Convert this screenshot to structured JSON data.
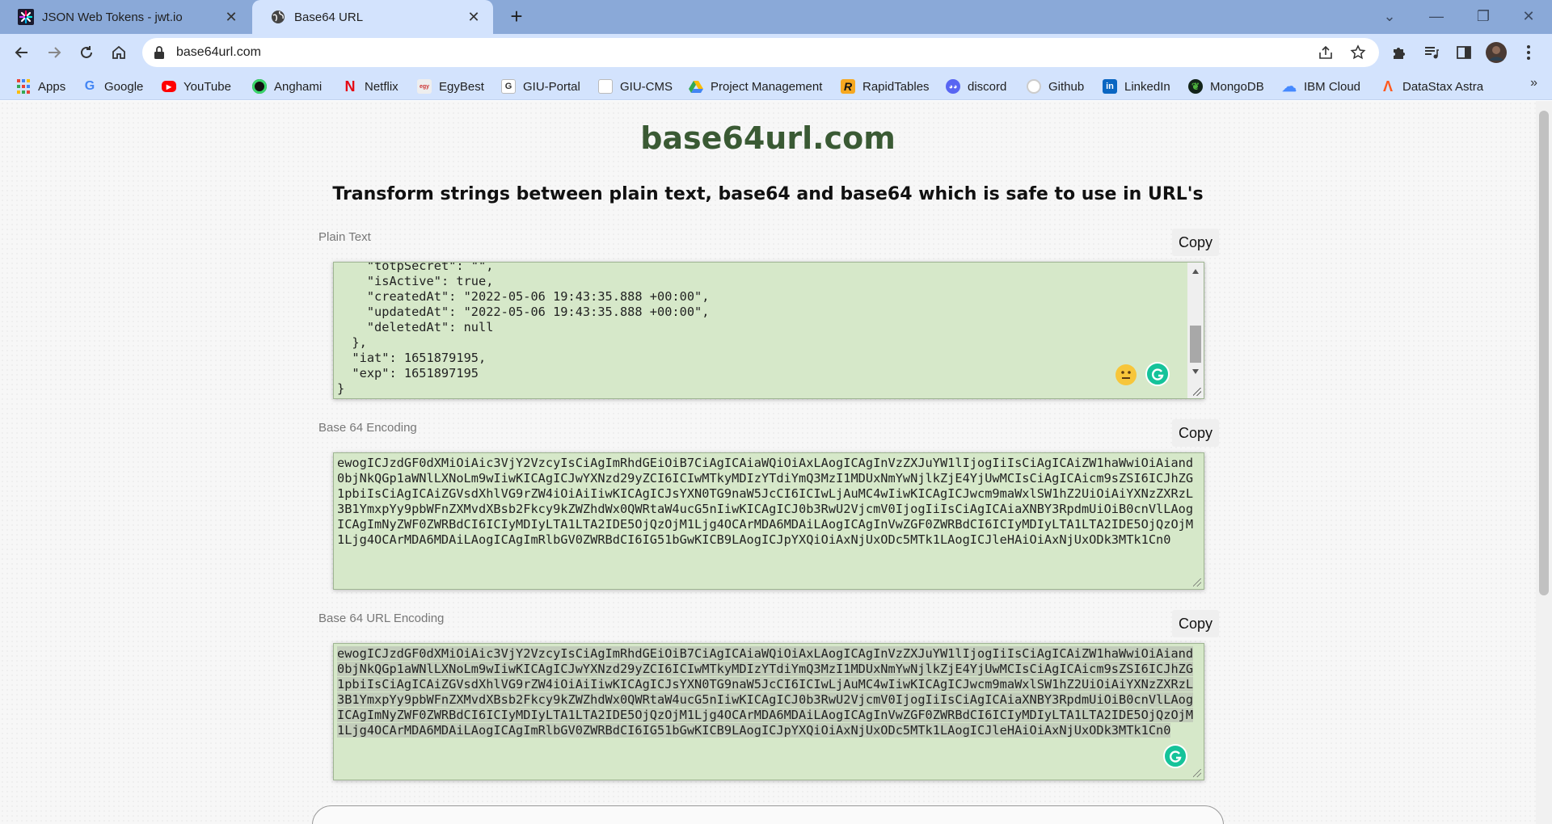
{
  "browser": {
    "tabs": [
      {
        "title": "JSON Web Tokens - jwt.io",
        "active": false
      },
      {
        "title": "Base64 URL",
        "active": true
      }
    ],
    "address": "base64url.com",
    "bookmarks": [
      {
        "label": "Apps",
        "icon": "apps-grid-icon"
      },
      {
        "label": "Google",
        "icon": "google-icon"
      },
      {
        "label": "YouTube",
        "icon": "youtube-icon"
      },
      {
        "label": "Anghami",
        "icon": "anghami-icon"
      },
      {
        "label": "Netflix",
        "icon": "netflix-icon"
      },
      {
        "label": "EgyBest",
        "icon": "egybest-icon"
      },
      {
        "label": "GIU-Portal",
        "icon": "giu-portal-icon"
      },
      {
        "label": "GIU-CMS",
        "icon": "giu-cms-icon"
      },
      {
        "label": "Project Management",
        "icon": "google-drive-icon"
      },
      {
        "label": "RapidTables",
        "icon": "rapidtables-icon"
      },
      {
        "label": "discord",
        "icon": "discord-icon"
      },
      {
        "label": "Github",
        "icon": "github-icon"
      },
      {
        "label": "LinkedIn",
        "icon": "linkedin-icon"
      },
      {
        "label": "MongoDB",
        "icon": "mongodb-icon"
      },
      {
        "label": "IBM Cloud",
        "icon": "ibm-cloud-icon"
      },
      {
        "label": "DataStax Astra",
        "icon": "datastax-icon"
      }
    ],
    "more_bookmarks": "»"
  },
  "page": {
    "site_title": "base64url.com",
    "subtitle": "Transform strings between plain text, base64 and base64 which is safe to use in URL's",
    "copy_label": "Copy",
    "plain": {
      "label": "Plain Text",
      "value": "    \"totpSecret\": \"\",\n    \"isActive\": true,\n    \"createdAt\": \"2022-05-06 19:43:35.888 +00:00\",\n    \"updatedAt\": \"2022-05-06 19:43:35.888 +00:00\",\n    \"deletedAt\": null\n  },\n  \"iat\": 1651879195,\n  \"exp\": 1651897195\n}"
    },
    "base64": {
      "label": "Base 64 Encoding",
      "value": "ewogICJzdGF0dXMiOiAic3VjY2VzcyIsCiAgImRhdGEiOiB7CiAgICAiaWQiOiAxLAogICAgInVzZXJuYW1lIjogIiIsCiAgICAiZW1haWwiOiAiand0bjNkQGp1aWNlLXNoLm9wIiwKICAgICJwYXNzd29yZCI6ICIwMTkyMDIzYTdiYmQ3MzI1MDUxNmYwNjlkZjE4YjUwMCIsCiAgICAicm9sZSI6ICJhZG1pbiIsCiAgICAiZGVsdXhlVG9rZW4iOiAiIiwKICAgICJsYXN0TG9naW5JcCI6ICIwLjAuMC4wIiwKICAgICJwcm9maWxlSW1hZ2UiOiAiYXNzZXRzL3B1YmxpYy9pbWFnZXMvdXBsb2Fkcy9kZWZhdWx0QWRtaW4ucG5nIiwKICAgICJ0b3RwU2VjcmV0IjogIiIsCiAgICAiaXNBY3RpdmUiOiB0cnVlLAogICAgImNyZWF0ZWRBdCI6ICIyMDIyLTA1LTA2IDE5OjQzOjM1Ljg4OCArMDA6MDAiLAogICAgInVwZGF0ZWRBdCI6ICIyMDIyLTA1LTA2IDE5OjQzOjM1Ljg4OCArMDA6MDAiLAogICAgImRlbGV0ZWRBdCI6IG51bGwKICB9LAogICJpYXQiOiAxNjUxODc5MTk1LAogICJleHAiOiAxNjUxODk3MTk1Cn0"
    },
    "base64url": {
      "label": "Base 64 URL Encoding",
      "value": "ewogICJzdGF0dXMiOiAic3VjY2VzcyIsCiAgImRhdGEiOiB7CiAgICAiaWQiOiAxLAogICAgInVzZXJuYW1lIjogIiIsCiAgICAiZW1haWwiOiAiand0bjNkQGp1aWNlLXNoLm9wIiwKICAgICJwYXNzd29yZCI6ICIwMTkyMDIzYTdiYmQ3MzI1MDUxNmYwNjlkZjE4YjUwMCIsCiAgICAicm9sZSI6ICJhZG1pbiIsCiAgICAiZGVsdXhlVG9rZW4iOiAiIiwKICAgICJsYXN0TG9naW5JcCI6ICIwLjAuMC4wIiwKICAgICJwcm9maWxlSW1hZ2UiOiAiYXNzZXRzL3B1YmxpYy9pbWFnZXMvdXBsb2Fkcy9kZWZhdWx0QWRtaW4ucG5nIiwKICAgICJ0b3RwU2VjcmV0IjogIiIsCiAgICAiaXNBY3RpdmUiOiB0cnVlLAogICAgImNyZWF0ZWRBdCI6ICIyMDIyLTA1LTA2IDE5OjQzOjM1Ljg4OCArMDA6MDAiLAogICAgInVwZGF0ZWRBdCI6ICIyMDIyLTA1LTA2IDE5OjQzOjM1Ljg4OCArMDA6MDAiLAogICAgImRlbGV0ZWRBdCI6IG51bGwKICB9LAogICJpYXQiOiAxNjUxODc5MTk1LAogICJleHAiOiAxNjUxODk3MTk1Cn0"
    }
  },
  "colors": {
    "tabstrip": "#8aa9d8",
    "toolbar": "#d3e3fd",
    "title_green": "#3a5a34",
    "textarea_bg": "#d6e8c9",
    "grammarly": "#15c39a"
  }
}
